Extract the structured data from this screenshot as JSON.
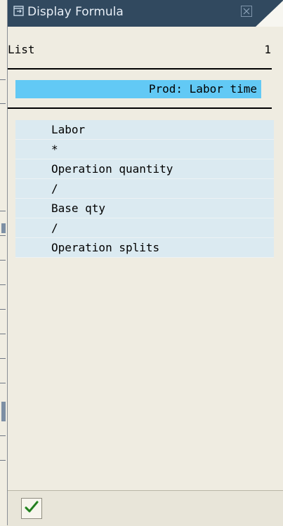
{
  "dialog": {
    "title": "Display Formula",
    "title_icon": "window-icon",
    "close_icon": "close-icon"
  },
  "list": {
    "label": "List",
    "count": "1"
  },
  "highlight": {
    "text": "Prod: Labor time"
  },
  "formula": {
    "items": [
      "Labor",
      "*",
      "Operation quantity",
      "/",
      "Base qty",
      "/",
      "Operation splits"
    ]
  },
  "footer": {
    "ok_icon": "checkmark-icon"
  },
  "colors": {
    "title_bar": "#31495f",
    "highlight": "#62c9f5",
    "row": "#dbeaf1",
    "background": "#efece1",
    "check": "#2f9a2a"
  }
}
